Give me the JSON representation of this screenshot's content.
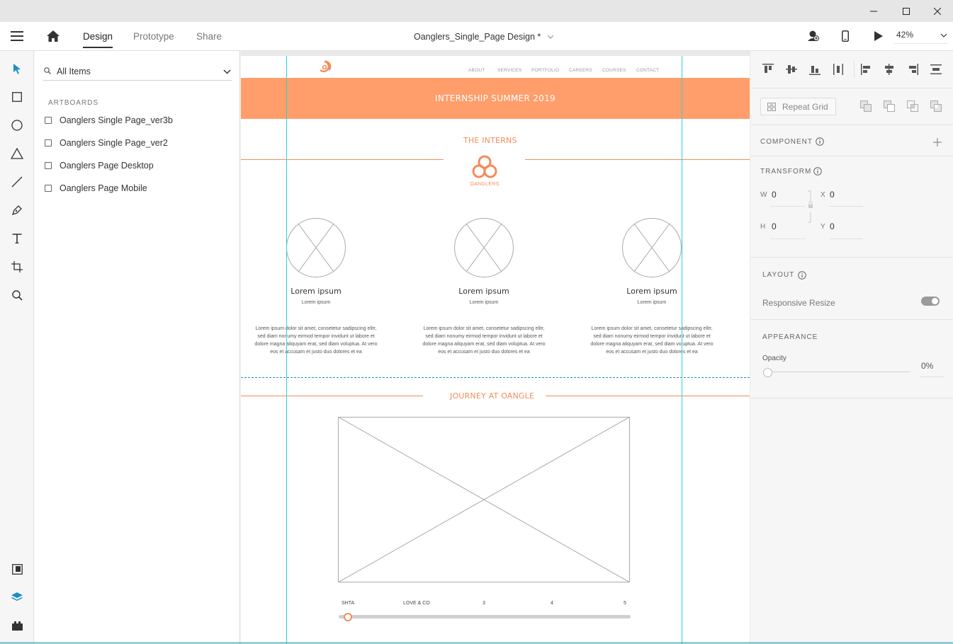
{
  "window": {
    "controls": [
      "minimize",
      "maximize",
      "close"
    ]
  },
  "appbar": {
    "tabs": [
      {
        "label": "Design",
        "active": true
      },
      {
        "label": "Prototype",
        "active": false
      },
      {
        "label": "Share",
        "active": false
      }
    ],
    "document_title": "Oanglers_Single_Page Design *",
    "zoom": "42%"
  },
  "toolbar": {
    "tools": [
      "select-icon",
      "rectangle-icon",
      "ellipse-icon",
      "triangle-icon",
      "line-icon",
      "pen-icon",
      "text-icon",
      "artboard-icon",
      "zoom-icon"
    ],
    "bottom": [
      "assets-icon",
      "layers-icon",
      "plugins-icon"
    ]
  },
  "layers": {
    "search_value": "All Items",
    "section": "ARTBOARDS",
    "artboards": [
      "Oanglers Single Page_ver3b",
      "Oanglers Single Page_ver2",
      "Oanglers Page Desktop",
      "Oanglers Page Mobile"
    ]
  },
  "artboard": {
    "nav": [
      "ABOUT",
      "SERVICES",
      "PORTFOLIO",
      "CAREERS",
      "COURSES",
      "CONTACT"
    ],
    "banner": "INTERNSHIP SUMMER 2019",
    "interns_title": "THE INTERNS",
    "logo_text": "OANGLERS",
    "interns": [
      {
        "name": "Lorem ipsum",
        "role": "Lorem ipsum",
        "bio": "Lorem ipsum dolor sit amet, consetetur sadipscing elitr, sed diam nonumy eirmod tempor invidunt ut labore et dolore magna aliquyam erat, sed diam voluptua. At vero eos et accusam et justo duo dolores et ea"
      },
      {
        "name": "Lorem ipsum",
        "role": "Lorem ipsum",
        "bio": "Lorem ipsum dolor sit amet, consetetur sadipscing elitr, sed diam nonumy eirmod tempor invidunt ut labore et dolore magna aliquyam erat, sed diam voluptua. At vero eos et accusam et justo duo dolores et ea"
      },
      {
        "name": "Lorem ipsum",
        "role": "Lorem ipsum",
        "bio": "Lorem ipsum dolor sit amet, consetetur sadipscing elitr, sed diam nonumy eirmod tempor invidunt ut labore et dolore magna aliquyam erat, sed diam voluptua. At vero eos et accusam et justo duo dolores et ea"
      }
    ],
    "journey_title": "JOURNEY AT OANGLE",
    "slider_labels": [
      "SHTA",
      "LOVE & CO",
      "3",
      "4",
      "5"
    ]
  },
  "properties": {
    "repeat_grid": "Repeat Grid",
    "component": "COMPONENT",
    "transform": "TRANSFORM",
    "w_label": "W",
    "w": "0",
    "x_label": "X",
    "x": "0",
    "h_label": "H",
    "h": "0",
    "y_label": "Y",
    "y": "0",
    "layout": "LAYOUT",
    "responsive_resize": "Responsive Resize",
    "responsive_on": true,
    "appearance": "APPEARANCE",
    "opacity_label": "Opacity",
    "opacity": "0%"
  },
  "colors": {
    "accent": "#ff9e6b",
    "orange_text": "#f48c5a",
    "guide": "#34cfd3",
    "select_tool": "#1a8fc7"
  }
}
